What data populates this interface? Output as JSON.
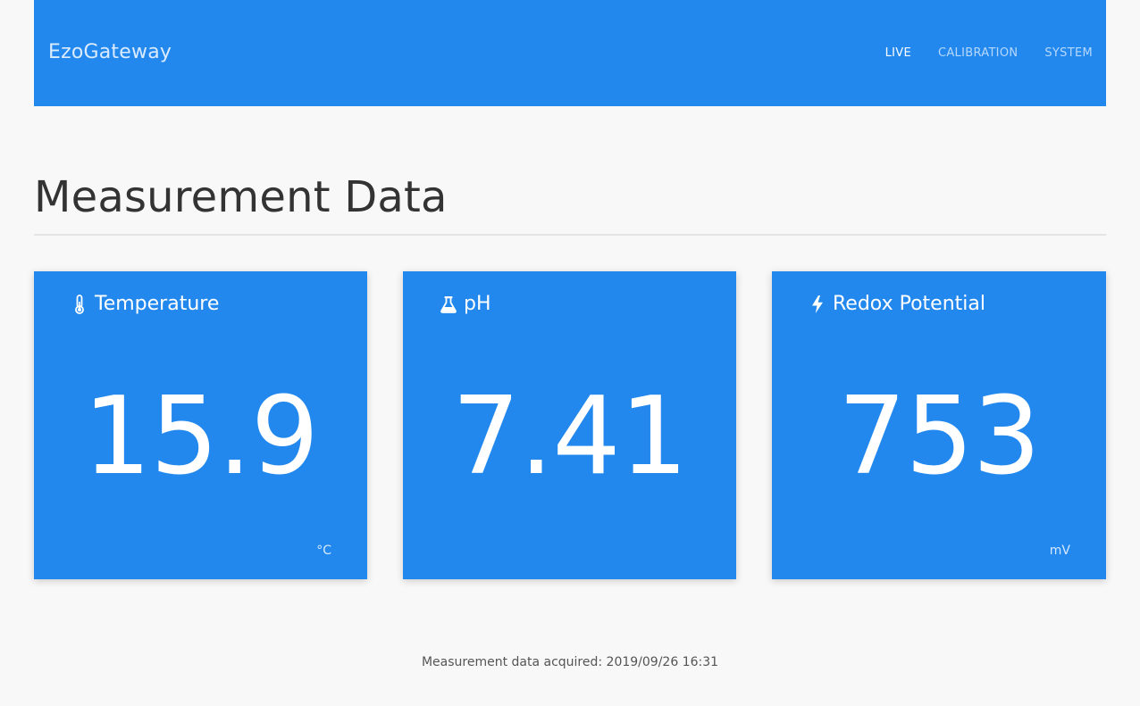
{
  "header": {
    "brand": "EzoGateway",
    "nav": [
      {
        "label": "LIVE",
        "active": true
      },
      {
        "label": "CALIBRATION",
        "active": false
      },
      {
        "label": "SYSTEM",
        "active": false
      }
    ]
  },
  "main": {
    "title": "Measurement Data",
    "cards": [
      {
        "label": "Temperature",
        "value": "15.9",
        "unit": "°C",
        "icon": "thermometer-icon"
      },
      {
        "label": "pH",
        "value": "7.41",
        "unit": "",
        "icon": "flask-icon"
      },
      {
        "label": "Redox Potential",
        "value": "753",
        "unit": "mV",
        "icon": "bolt-icon"
      }
    ]
  },
  "footer": {
    "note": "Measurement data acquired: 2019/09/26 16:31"
  },
  "colors": {
    "accent": "#2288ee",
    "background": "#f8f8f8",
    "title_text": "#333333"
  }
}
